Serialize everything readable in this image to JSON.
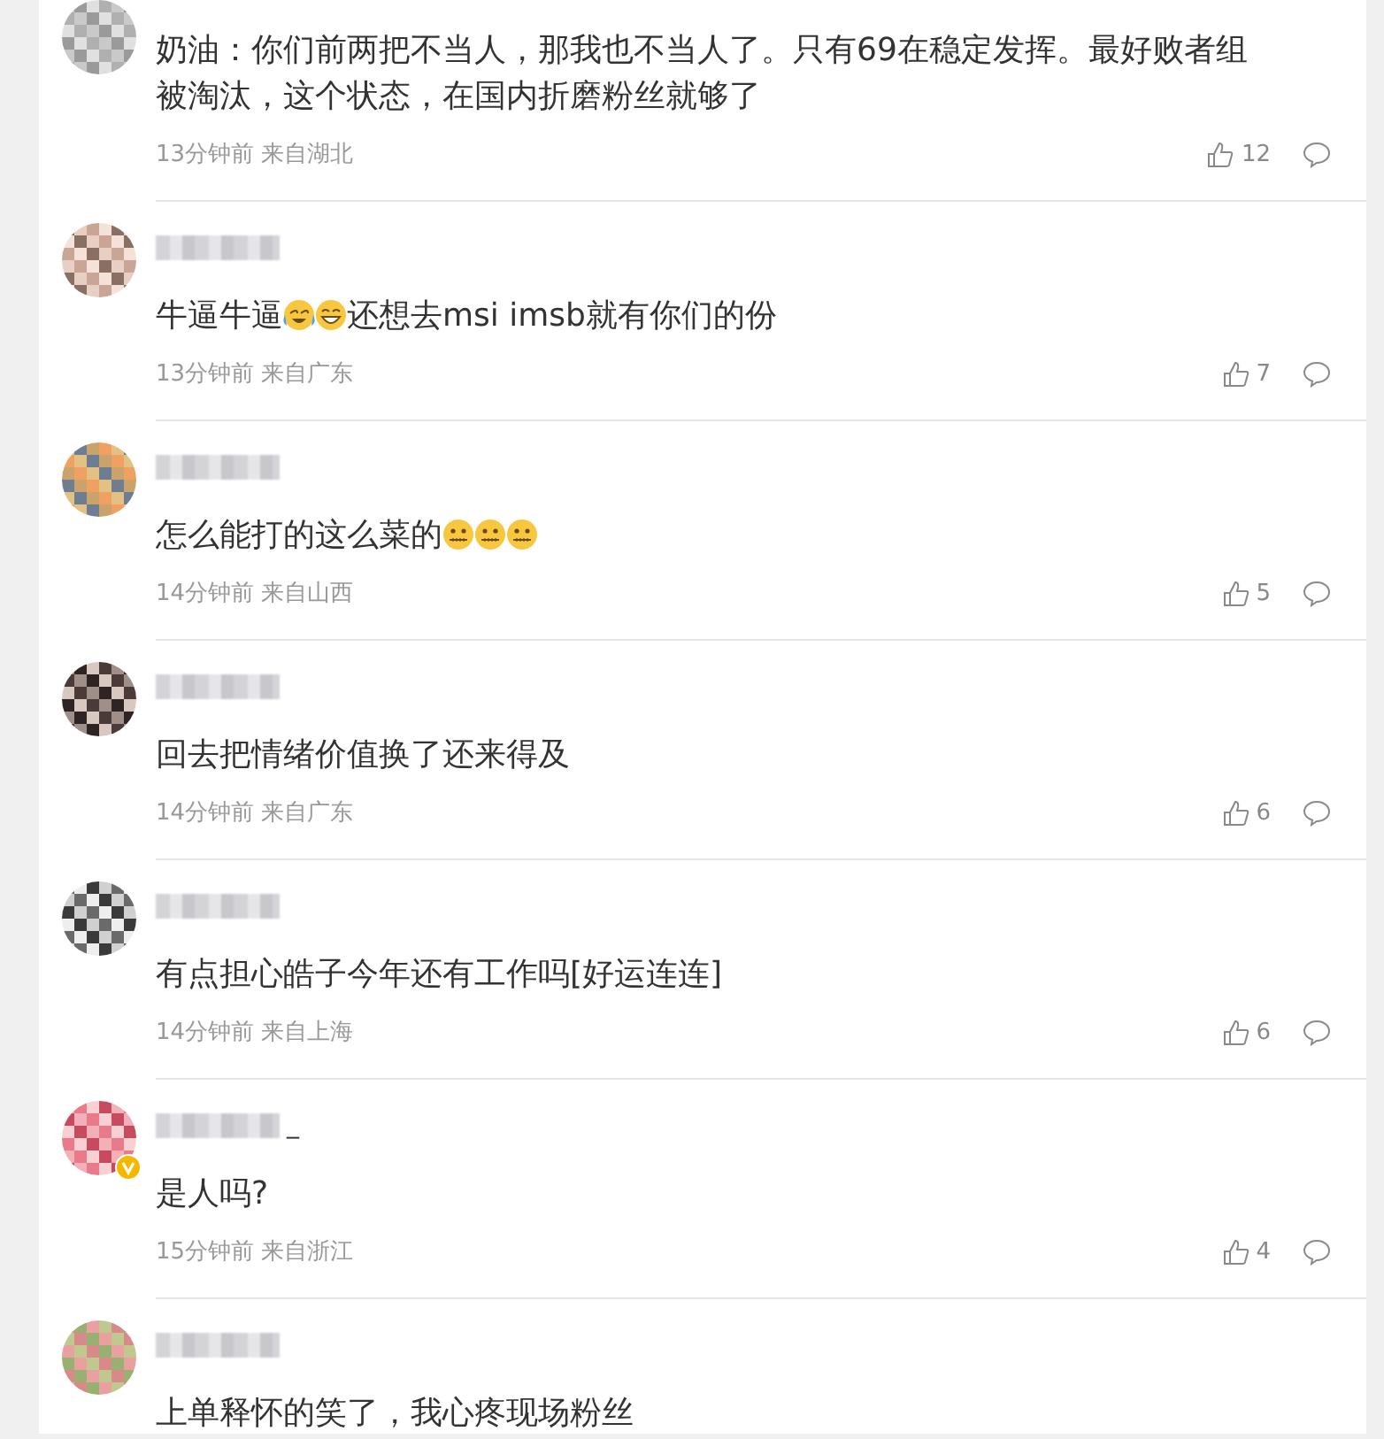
{
  "comments": [
    {
      "name_shown": false,
      "verified": false,
      "content": [
        {
          "kind": "text",
          "text": "奶油：你们前两把不当人，那我也不当人了。只有69在稳定发挥。最好败者组被淘汰，这个状态，在国内折磨粉丝就够了"
        }
      ],
      "time": "13分钟前",
      "location": "来自湖北",
      "likes": "12"
    },
    {
      "name_shown": true,
      "verified": false,
      "content": [
        {
          "kind": "text",
          "text": "牛逼牛逼"
        },
        {
          "kind": "tears"
        },
        {
          "kind": "laugh"
        },
        {
          "kind": "text",
          "text": "还想去msi imsb就有你们的份"
        }
      ],
      "time": "13分钟前",
      "location": "来自广东",
      "likes": "7"
    },
    {
      "name_shown": true,
      "verified": false,
      "content": [
        {
          "kind": "text",
          "text": "怎么能打的这么菜的"
        },
        {
          "kind": "zipped"
        },
        {
          "kind": "zipped"
        },
        {
          "kind": "zipped"
        }
      ],
      "time": "14分钟前",
      "location": "来自山西",
      "likes": "5"
    },
    {
      "name_shown": true,
      "verified": false,
      "content": [
        {
          "kind": "text",
          "text": "回去把情绪价值换了还来得及"
        }
      ],
      "time": "14分钟前",
      "location": "来自广东",
      "likes": "6"
    },
    {
      "name_shown": true,
      "verified": false,
      "content": [
        {
          "kind": "text",
          "text": "有点担心皓子今年还有工作吗[好运连连]"
        }
      ],
      "time": "14分钟前",
      "location": "来自上海",
      "likes": "6"
    },
    {
      "name_shown": true,
      "verified": true,
      "name_suffix": "_",
      "content": [
        {
          "kind": "text",
          "text": "是人吗?"
        }
      ],
      "time": "15分钟前",
      "location": "来自浙江",
      "likes": "4"
    },
    {
      "name_shown": true,
      "verified": false,
      "content": [
        {
          "kind": "text",
          "text": "上单释怀的笑了，我心疼现场粉丝"
        }
      ]
    }
  ]
}
